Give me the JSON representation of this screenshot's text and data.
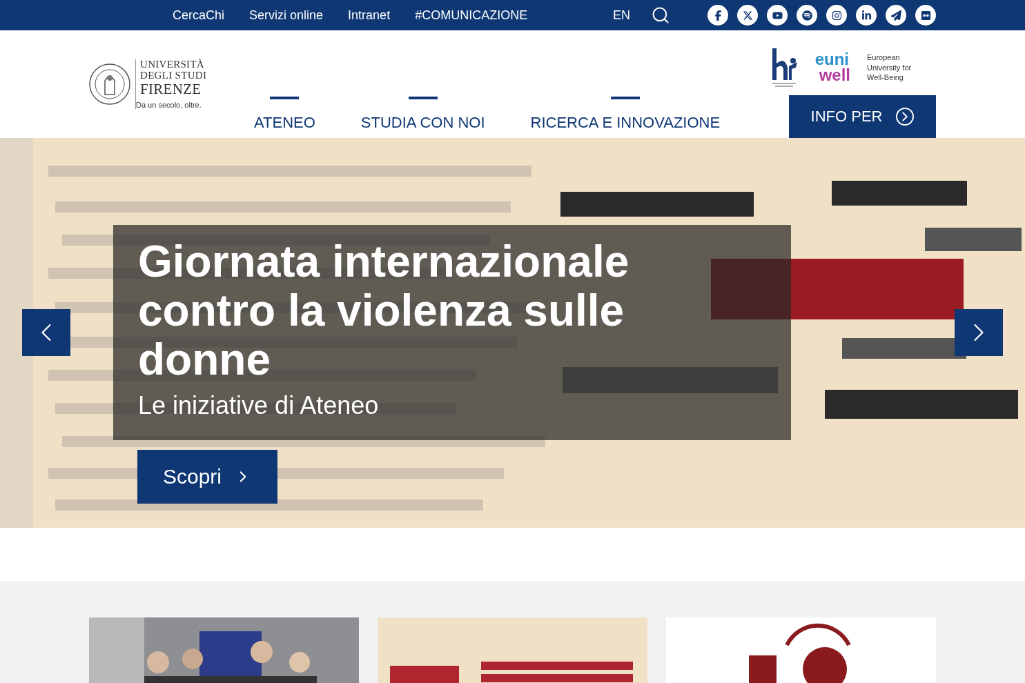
{
  "top_bar": {
    "links": [
      "CercaChi",
      "Servizi online",
      "Intranet",
      "#COMUNICAZIONE"
    ],
    "language": "EN",
    "social": [
      {
        "kind": "facebook"
      },
      {
        "kind": "x"
      },
      {
        "kind": "youtube"
      },
      {
        "kind": "spotify"
      },
      {
        "kind": "instagram"
      },
      {
        "kind": "linkedin"
      },
      {
        "kind": "telegram"
      },
      {
        "kind": "flickr"
      }
    ]
  },
  "logo": {
    "name_lines": [
      "UNIVERSITÀ",
      "DEGLI STUDI",
      "FIRENZE"
    ],
    "tagline": "Da un secolo, oltre."
  },
  "partner": {
    "euni": "euni",
    "well": "well",
    "caption": "European University for Well-Being"
  },
  "nav": {
    "items": [
      "ATENEO",
      "STUDIA CON NOI",
      "RICERCA E INNOVAZIONE"
    ],
    "info_button": "INFO PER"
  },
  "hero": {
    "kind": "picture",
    "title": "Giornata internazionale contro la violenza sulle donne",
    "subtitle": "Le iniziative di Ateneo",
    "button": "Scopri"
  }
}
